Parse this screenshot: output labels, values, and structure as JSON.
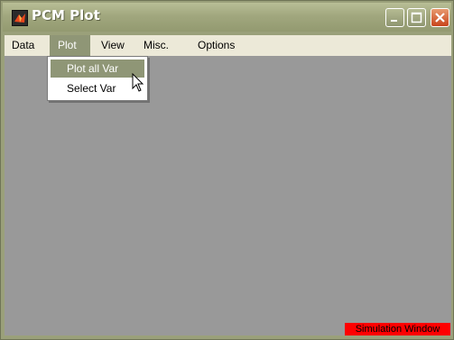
{
  "window": {
    "title": "PCM Plot"
  },
  "menubar": {
    "items": [
      {
        "label": "Data"
      },
      {
        "label": "Plot"
      },
      {
        "label": "View"
      },
      {
        "label": "Misc."
      },
      {
        "label": "Options"
      }
    ]
  },
  "plot_menu": {
    "items": [
      {
        "label": "Plot all Var"
      },
      {
        "label": "Select Var"
      }
    ]
  },
  "status": {
    "label": "Simulation Window"
  },
  "colors": {
    "titlebar": "#a1a77e",
    "canvas": "#999999",
    "menu_highlight": "#8f9676",
    "status_bg": "#ff0000"
  },
  "icons": {
    "app": "matlab-icon",
    "minimize": "minimize-icon",
    "maximize": "maximize-icon",
    "close": "close-icon",
    "cursor": "mouse-cursor-icon"
  }
}
